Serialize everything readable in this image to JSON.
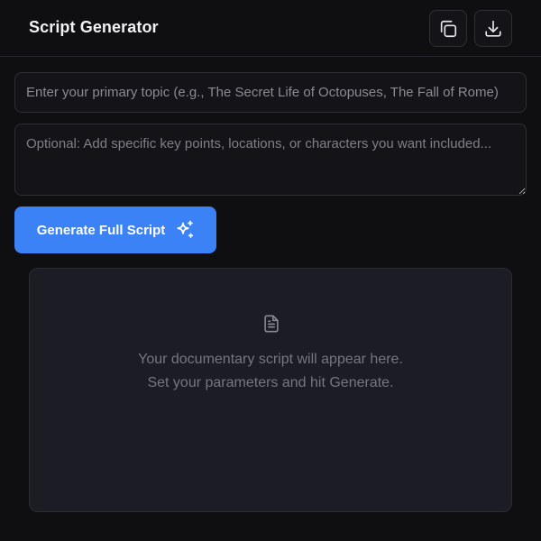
{
  "header": {
    "title": "Script Generator",
    "copy_icon": "copy-icon",
    "download_icon": "download-icon"
  },
  "form": {
    "topic": {
      "value": "",
      "placeholder": "Enter your primary topic (e.g., The Secret Life of Octopuses, The Fall of Rome)"
    },
    "details": {
      "value": "",
      "placeholder": "Optional: Add specific key points, locations, or characters you want included..."
    },
    "generate_label": "Generate Full Script",
    "generate_icon": "sparkles-icon"
  },
  "output": {
    "icon": "file-text-icon",
    "empty_line_1": "Your documentary script will appear here.",
    "empty_line_2": "Set your parameters and hit Generate."
  },
  "colors": {
    "background": "#0f0f12",
    "accent": "#3b82f6",
    "panel": "#1c1c24"
  }
}
